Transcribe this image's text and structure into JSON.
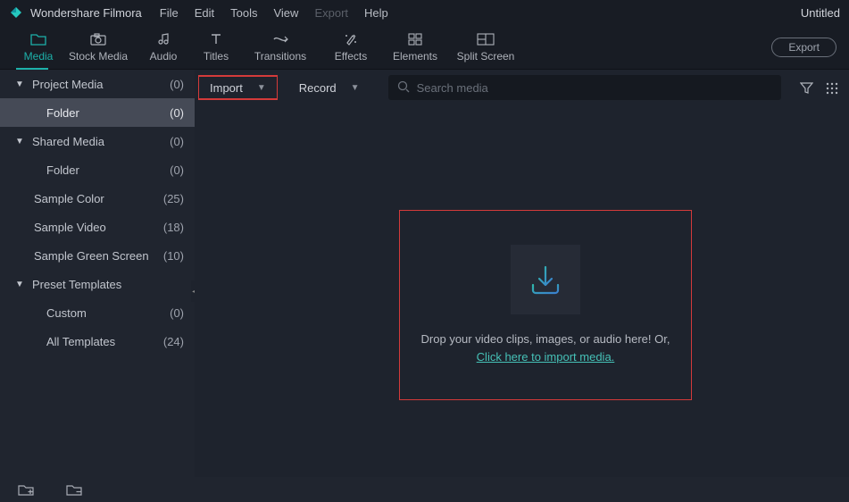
{
  "app": {
    "name": "Wondershare Filmora",
    "project_title": "Untitled"
  },
  "menu": {
    "file": "File",
    "edit": "Edit",
    "tools": "Tools",
    "view": "View",
    "export": "Export",
    "help": "Help"
  },
  "tool_tabs": {
    "media": "Media",
    "stock_media": "Stock Media",
    "audio": "Audio",
    "titles": "Titles",
    "transitions": "Transitions",
    "effects": "Effects",
    "elements": "Elements",
    "split_screen": "Split Screen",
    "export_btn": "Export"
  },
  "sidebar": [
    {
      "label": "Project Media",
      "count": "(0)",
      "type": "header"
    },
    {
      "label": "Folder",
      "count": "(0)",
      "type": "child",
      "active": true
    },
    {
      "label": "Shared Media",
      "count": "(0)",
      "type": "header"
    },
    {
      "label": "Folder",
      "count": "(0)",
      "type": "child"
    },
    {
      "label": "Sample Color",
      "count": "(25)",
      "type": "item"
    },
    {
      "label": "Sample Video",
      "count": "(18)",
      "type": "item"
    },
    {
      "label": "Sample Green Screen",
      "count": "(10)",
      "type": "item"
    },
    {
      "label": "Preset Templates",
      "count": "",
      "type": "header"
    },
    {
      "label": "Custom",
      "count": "(0)",
      "type": "child"
    },
    {
      "label": "All Templates",
      "count": "(24)",
      "type": "child"
    }
  ],
  "actions": {
    "import": "Import",
    "record": "Record",
    "search_placeholder": "Search media"
  },
  "drop": {
    "text1": "Drop your video clips, images, or audio here! Or,",
    "link": "Click here to import media."
  }
}
